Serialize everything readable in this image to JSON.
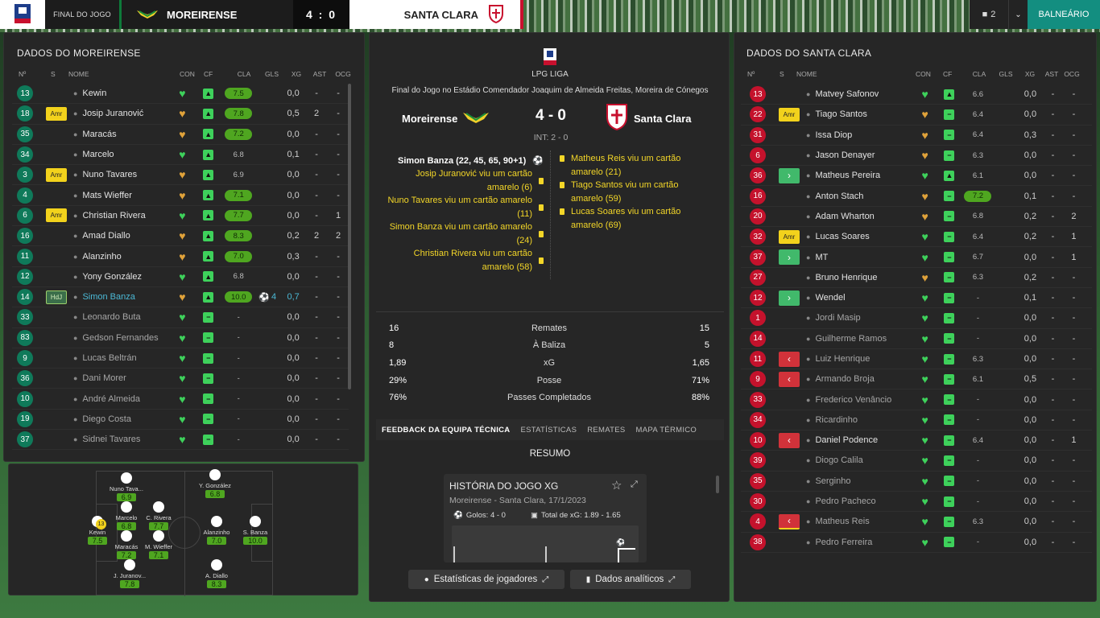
{
  "topbar": {
    "status": "FINAL DO JOGO",
    "home": "MOREIRENSE",
    "score": "4 : 0",
    "away": "SANTA CLARA",
    "user_count": "2",
    "right_button": "BALNEÁRIO"
  },
  "left": {
    "title": "DADOS DO MOREIRENSE",
    "headers": [
      "Nº",
      "S",
      "NOME",
      "CON",
      "CF",
      "CLA",
      "GLS",
      "XG",
      "AST",
      "OCG"
    ],
    "players": [
      {
        "no": "13",
        "s": "",
        "name": "Kewin",
        "cla": "7.5",
        "clagood": true,
        "gls": "",
        "xg": "0,0",
        "ast": "-",
        "ocg": "-",
        "st": "n"
      },
      {
        "no": "18",
        "s": "Amr",
        "name": "Josip Juranović",
        "cla": "7.8",
        "clagood": true,
        "gls": "",
        "xg": "0,5",
        "ast": "2",
        "ocg": "-",
        "st": "n"
      },
      {
        "no": "35",
        "s": "",
        "name": "Maracás",
        "cla": "7.2",
        "clagood": true,
        "gls": "",
        "xg": "0,0",
        "ast": "-",
        "ocg": "-",
        "st": "n"
      },
      {
        "no": "34",
        "s": "",
        "name": "Marcelo",
        "cla": "6.8",
        "clagood": false,
        "gls": "",
        "xg": "0,1",
        "ast": "-",
        "ocg": "-",
        "st": "n"
      },
      {
        "no": "3",
        "s": "Amr",
        "name": "Nuno Tavares",
        "cla": "6.9",
        "clagood": false,
        "gls": "",
        "xg": "0,0",
        "ast": "-",
        "ocg": "-",
        "st": "n"
      },
      {
        "no": "4",
        "s": "",
        "name": "Mats Wieffer",
        "cla": "7.1",
        "clagood": true,
        "gls": "",
        "xg": "0,0",
        "ast": "-",
        "ocg": "-",
        "st": "n"
      },
      {
        "no": "6",
        "s": "Amr",
        "name": "Christian Rivera",
        "cla": "7.7",
        "clagood": true,
        "gls": "",
        "xg": "0,0",
        "ast": "-",
        "ocg": "1",
        "st": "n"
      },
      {
        "no": "16",
        "s": "",
        "name": "Amad Diallo",
        "cla": "8.3",
        "clagood": true,
        "gls": "",
        "xg": "0,2",
        "ast": "2",
        "ocg": "2",
        "st": "n"
      },
      {
        "no": "11",
        "s": "",
        "name": "Alanzinho",
        "cla": "7.0",
        "clagood": true,
        "gls": "",
        "xg": "0,3",
        "ast": "-",
        "ocg": "-",
        "st": "n"
      },
      {
        "no": "12",
        "s": "",
        "name": "Yony González",
        "cla": "6.8",
        "clagood": false,
        "gls": "",
        "xg": "0,0",
        "ast": "-",
        "ocg": "-",
        "st": "n"
      },
      {
        "no": "14",
        "s": "HdJ",
        "name": "Simon Banza",
        "cla": "10.0",
        "clagood": true,
        "gls": "4",
        "xg": "0,7",
        "ast": "-",
        "ocg": "-",
        "st": "hl"
      },
      {
        "no": "33",
        "s": "",
        "name": "Leonardo Buta",
        "cla": "-",
        "clagood": false,
        "gls": "",
        "xg": "0,0",
        "ast": "-",
        "ocg": "-",
        "st": "sub"
      },
      {
        "no": "83",
        "s": "",
        "name": "Gedson Fernandes",
        "cla": "-",
        "clagood": false,
        "gls": "",
        "xg": "0,0",
        "ast": "-",
        "ocg": "-",
        "st": "sub"
      },
      {
        "no": "9",
        "s": "",
        "name": "Lucas Beltrán",
        "cla": "-",
        "clagood": false,
        "gls": "",
        "xg": "0,0",
        "ast": "-",
        "ocg": "-",
        "st": "sub"
      },
      {
        "no": "36",
        "s": "",
        "name": "Dani Morer",
        "cla": "-",
        "clagood": false,
        "gls": "",
        "xg": "0,0",
        "ast": "-",
        "ocg": "-",
        "st": "sub"
      },
      {
        "no": "10",
        "s": "",
        "name": "André Almeida",
        "cla": "-",
        "clagood": false,
        "gls": "",
        "xg": "0,0",
        "ast": "-",
        "ocg": "-",
        "st": "sub"
      },
      {
        "no": "19",
        "s": "",
        "name": "Diego Costa",
        "cla": "-",
        "clagood": false,
        "gls": "",
        "xg": "0,0",
        "ast": "-",
        "ocg": "-",
        "st": "sub"
      },
      {
        "no": "37",
        "s": "",
        "name": "Sidnei Tavares",
        "cla": "-",
        "clagood": false,
        "gls": "",
        "xg": "0,0",
        "ast": "-",
        "ocg": "-",
        "st": "sub"
      }
    ]
  },
  "pitch": {
    "players": [
      {
        "name": "Nuno Tava...",
        "rating": "6.9"
      },
      {
        "name": "Y. González",
        "rating": "6.8"
      },
      {
        "name": "Marcelo",
        "rating": "6.8"
      },
      {
        "name": "C. Rivera",
        "rating": "7.7"
      },
      {
        "name": "Kewin",
        "rating": "7.5"
      },
      {
        "name": "Alanzinho",
        "rating": "7.0"
      },
      {
        "name": "S. Banza",
        "rating": "10.0"
      },
      {
        "name": "Maracás",
        "rating": "7.2"
      },
      {
        "name": "M. Wieffer",
        "rating": "7.1"
      },
      {
        "name": "J. Juranov...",
        "rating": "7.8"
      },
      {
        "name": "A. Diallo",
        "rating": "8.3"
      }
    ],
    "captain_no": "13"
  },
  "center": {
    "league": "LPG LIGA",
    "venue": "Final do Jogo no Estádio Comendador Joaquim de Almeida Freitas, Moreira de Cónegos",
    "home": "Moreirense",
    "away": "Santa Clara",
    "score": "4 - 0",
    "ht": "INT: 2 - 0",
    "home_events": [
      "Simon Banza (22, 45, 65, 90+1)",
      "Josip Juranović viu um cartão amarelo (6)",
      "Nuno Tavares viu um cartão amarelo (11)",
      "Simon Banza viu um cartão amarelo (24)",
      "Christian Rivera viu um cartão amarelo (58)"
    ],
    "away_events": [
      "Matheus Reis viu um cartão amarelo (21)",
      "Tiago Santos viu um cartão amarelo (59)",
      "Lucas Soares viu um cartão amarelo (69)"
    ],
    "stats": [
      {
        "home": "16",
        "label": "Remates",
        "away": "15"
      },
      {
        "home": "8",
        "label": "À Baliza",
        "away": "5"
      },
      {
        "home": "1,89",
        "label": "xG",
        "away": "1,65"
      },
      {
        "home": "29%",
        "label": "Posse",
        "away": "71%"
      },
      {
        "home": "76%",
        "label": "Passes Completados",
        "away": "88%"
      }
    ],
    "tabs": [
      "FEEDBACK DA EQUIPA TÉCNICA",
      "ESTATÍSTICAS",
      "REMATES",
      "MAPA TÉRMICO"
    ],
    "summary": "RESUMO",
    "card": {
      "title": "HISTÓRIA DO JOGO XG",
      "subtitle": "Moreirense - Santa Clara, 17/1/2023",
      "goals": "Golos: 4 - 0",
      "xg": "Total de xG: 1.89 - 1.65"
    },
    "btn1": "Estatísticas de jogadores",
    "btn2": "Dados analíticos"
  },
  "right": {
    "title": "DADOS DO SANTA CLARA",
    "headers": [
      "Nº",
      "S",
      "NOME",
      "CON",
      "CF",
      "CLA",
      "GLS",
      "XG",
      "AST",
      "OCG"
    ],
    "players": [
      {
        "no": "13",
        "s": "",
        "name": "Matvey Safonov",
        "cla": "6.6",
        "clagood": false,
        "xg": "0,0",
        "ast": "-",
        "ocg": "-",
        "st": "n"
      },
      {
        "no": "22",
        "s": "Amr",
        "name": "Tiago Santos",
        "cla": "6.4",
        "clagood": false,
        "xg": "0,0",
        "ast": "-",
        "ocg": "-",
        "st": "n"
      },
      {
        "no": "31",
        "s": "",
        "name": "Issa Diop",
        "cla": "6.4",
        "clagood": false,
        "xg": "0,3",
        "ast": "-",
        "ocg": "-",
        "st": "n"
      },
      {
        "no": "6",
        "s": "",
        "name": "Jason Denayer",
        "cla": "6.3",
        "clagood": false,
        "xg": "0,0",
        "ast": "-",
        "ocg": "-",
        "st": "n"
      },
      {
        "no": "36",
        "s": "in",
        "name": "Matheus Pereira",
        "cla": "6.1",
        "clagood": false,
        "xg": "0,0",
        "ast": "-",
        "ocg": "-",
        "st": "n"
      },
      {
        "no": "16",
        "s": "",
        "name": "Anton Stach",
        "cla": "7.2",
        "clagood": true,
        "xg": "0,1",
        "ast": "-",
        "ocg": "-",
        "st": "n"
      },
      {
        "no": "20",
        "s": "",
        "name": "Adam Wharton",
        "cla": "6.8",
        "clagood": false,
        "xg": "0,2",
        "ast": "-",
        "ocg": "2",
        "st": "n"
      },
      {
        "no": "32",
        "s": "Amr",
        "name": "Lucas Soares",
        "cla": "6.4",
        "clagood": false,
        "xg": "0,2",
        "ast": "-",
        "ocg": "1",
        "st": "n"
      },
      {
        "no": "37",
        "s": "in",
        "name": "MT",
        "cla": "6.7",
        "clagood": false,
        "xg": "0,0",
        "ast": "-",
        "ocg": "1",
        "st": "n"
      },
      {
        "no": "27",
        "s": "",
        "name": "Bruno Henrique",
        "cla": "6.3",
        "clagood": false,
        "xg": "0,2",
        "ast": "-",
        "ocg": "-",
        "st": "n"
      },
      {
        "no": "12",
        "s": "in",
        "name": "Wendel",
        "cla": "-",
        "clagood": false,
        "xg": "0,1",
        "ast": "-",
        "ocg": "-",
        "st": "n"
      },
      {
        "no": "1",
        "s": "",
        "name": "Jordi Masip",
        "cla": "-",
        "clagood": false,
        "xg": "0,0",
        "ast": "-",
        "ocg": "-",
        "st": "sub"
      },
      {
        "no": "14",
        "s": "",
        "name": "Guilherme Ramos",
        "cla": "-",
        "clagood": false,
        "xg": "0,0",
        "ast": "-",
        "ocg": "-",
        "st": "sub"
      },
      {
        "no": "11",
        "s": "out",
        "name": "Luiz Henrique",
        "cla": "6.3",
        "clagood": false,
        "xg": "0,0",
        "ast": "-",
        "ocg": "-",
        "st": "sub"
      },
      {
        "no": "9",
        "s": "out",
        "name": "Armando Broja",
        "cla": "6.1",
        "clagood": false,
        "xg": "0,5",
        "ast": "-",
        "ocg": "-",
        "st": "sub"
      },
      {
        "no": "33",
        "s": "",
        "name": "Frederico Venâncio",
        "cla": "-",
        "clagood": false,
        "xg": "0,0",
        "ast": "-",
        "ocg": "-",
        "st": "sub"
      },
      {
        "no": "34",
        "s": "",
        "name": "Ricardinho",
        "cla": "-",
        "clagood": false,
        "xg": "0,0",
        "ast": "-",
        "ocg": "-",
        "st": "sub"
      },
      {
        "no": "10",
        "s": "out",
        "name": "Daniel Podence",
        "cla": "6.4",
        "clagood": false,
        "xg": "0,0",
        "ast": "-",
        "ocg": "1",
        "st": "n"
      },
      {
        "no": "39",
        "s": "",
        "name": "Diogo Calila",
        "cla": "-",
        "clagood": false,
        "xg": "0,0",
        "ast": "-",
        "ocg": "-",
        "st": "sub"
      },
      {
        "no": "35",
        "s": "",
        "name": "Serginho",
        "cla": "-",
        "clagood": false,
        "xg": "0,0",
        "ast": "-",
        "ocg": "-",
        "st": "sub"
      },
      {
        "no": "30",
        "s": "",
        "name": "Pedro Pacheco",
        "cla": "-",
        "clagood": false,
        "xg": "0,0",
        "ast": "-",
        "ocg": "-",
        "st": "sub"
      },
      {
        "no": "4",
        "s": "outy",
        "name": "Matheus Reis",
        "cla": "6.3",
        "clagood": false,
        "xg": "0,0",
        "ast": "-",
        "ocg": "-",
        "st": "sub"
      },
      {
        "no": "38",
        "s": "",
        "name": "Pedro Ferreira",
        "cla": "-",
        "clagood": false,
        "xg": "0,0",
        "ast": "-",
        "ocg": "-",
        "st": "sub"
      }
    ]
  }
}
